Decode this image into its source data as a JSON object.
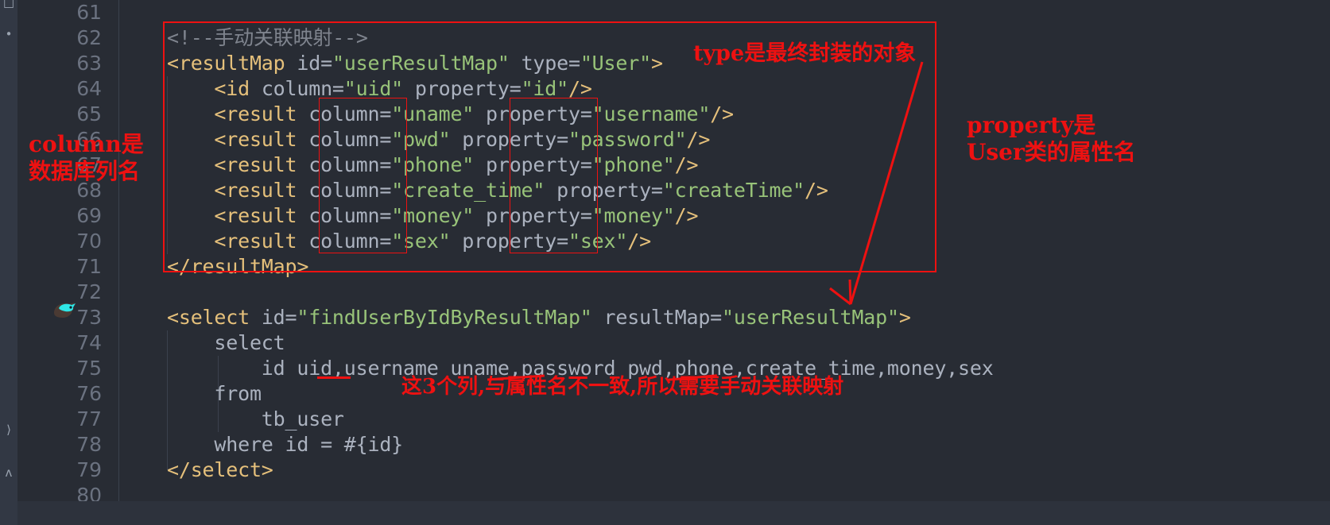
{
  "editor": {
    "background": "#282c34",
    "gutter_background": "#282c34",
    "strip_background": "#323844",
    "linenumber_color": "#6b7280",
    "annotation_color": "#ee1111",
    "line_numbers": [
      "61",
      "62",
      "63",
      "64",
      "65",
      "66",
      "67",
      "68",
      "69",
      "70",
      "71",
      "72",
      "73",
      "74",
      "75",
      "76",
      "77",
      "78",
      "79",
      "80"
    ],
    "gutter_icon_name": "mybatis-statement-gutter-icon"
  },
  "left_strip": {
    "glyphs": [
      "□",
      "•",
      "⟩",
      "ʌ"
    ]
  },
  "code": {
    "lines": [
      {
        "num": "61",
        "segments": []
      },
      {
        "num": "62",
        "segments": [
          {
            "t": "comment",
            "s": "<!--手动关联映射-->"
          }
        ]
      },
      {
        "num": "63",
        "segments": [
          {
            "t": "tag",
            "s": "<resultMap "
          },
          {
            "t": "attr",
            "s": "id="
          },
          {
            "t": "str",
            "s": "\"userResultMap\""
          },
          {
            "t": "attr",
            "s": " type="
          },
          {
            "t": "str",
            "s": "\"User\""
          },
          {
            "t": "tag",
            "s": ">"
          }
        ]
      },
      {
        "num": "64",
        "segments": [
          {
            "t": "plain",
            "s": "    "
          },
          {
            "t": "tag",
            "s": "<id "
          },
          {
            "t": "attr",
            "s": "column="
          },
          {
            "t": "str",
            "s": "\"uid\""
          },
          {
            "t": "attr",
            "s": " property="
          },
          {
            "t": "str",
            "s": "\"id\""
          },
          {
            "t": "tag",
            "s": "/>"
          }
        ]
      },
      {
        "num": "65",
        "segments": [
          {
            "t": "plain",
            "s": "    "
          },
          {
            "t": "tag",
            "s": "<result "
          },
          {
            "t": "attr",
            "s": "column="
          },
          {
            "t": "str",
            "s": "\"uname\""
          },
          {
            "t": "attr",
            "s": " property="
          },
          {
            "t": "str",
            "s": "\"username\""
          },
          {
            "t": "tag",
            "s": "/>"
          }
        ]
      },
      {
        "num": "66",
        "segments": [
          {
            "t": "plain",
            "s": "    "
          },
          {
            "t": "tag",
            "s": "<result "
          },
          {
            "t": "attr",
            "s": "column="
          },
          {
            "t": "str",
            "s": "\"pwd\""
          },
          {
            "t": "attr",
            "s": " property="
          },
          {
            "t": "str",
            "s": "\"password\""
          },
          {
            "t": "tag",
            "s": "/>"
          }
        ]
      },
      {
        "num": "67",
        "segments": [
          {
            "t": "plain",
            "s": "    "
          },
          {
            "t": "tag",
            "s": "<result "
          },
          {
            "t": "attr",
            "s": "column="
          },
          {
            "t": "str",
            "s": "\"phone\""
          },
          {
            "t": "attr",
            "s": " property="
          },
          {
            "t": "str",
            "s": "\"phone\""
          },
          {
            "t": "tag",
            "s": "/>"
          }
        ]
      },
      {
        "num": "68",
        "segments": [
          {
            "t": "plain",
            "s": "    "
          },
          {
            "t": "tag",
            "s": "<result "
          },
          {
            "t": "attr",
            "s": "column="
          },
          {
            "t": "str",
            "s": "\"create_time\""
          },
          {
            "t": "attr",
            "s": " property="
          },
          {
            "t": "str",
            "s": "\"createTime\""
          },
          {
            "t": "tag",
            "s": "/>"
          }
        ]
      },
      {
        "num": "69",
        "segments": [
          {
            "t": "plain",
            "s": "    "
          },
          {
            "t": "tag",
            "s": "<result "
          },
          {
            "t": "attr",
            "s": "column="
          },
          {
            "t": "str",
            "s": "\"money\""
          },
          {
            "t": "attr",
            "s": " property="
          },
          {
            "t": "str",
            "s": "\"money\""
          },
          {
            "t": "tag",
            "s": "/>"
          }
        ]
      },
      {
        "num": "70",
        "segments": [
          {
            "t": "plain",
            "s": "    "
          },
          {
            "t": "tag",
            "s": "<result "
          },
          {
            "t": "attr",
            "s": "column="
          },
          {
            "t": "str",
            "s": "\"sex\""
          },
          {
            "t": "attr",
            "s": " property="
          },
          {
            "t": "str",
            "s": "\"sex\""
          },
          {
            "t": "tag",
            "s": "/>"
          }
        ]
      },
      {
        "num": "71",
        "segments": [
          {
            "t": "tag",
            "s": "</resultMap>"
          }
        ]
      },
      {
        "num": "72",
        "segments": []
      },
      {
        "num": "73",
        "segments": [
          {
            "t": "tag",
            "s": "<select "
          },
          {
            "t": "attr",
            "s": "id="
          },
          {
            "t": "str",
            "s": "\"findUserByIdByResultMap\""
          },
          {
            "t": "attr",
            "s": " resultMap="
          },
          {
            "t": "str",
            "s": "\"userResultMap\""
          },
          {
            "t": "tag",
            "s": ">"
          }
        ]
      },
      {
        "num": "74",
        "segments": [
          {
            "t": "plain",
            "s": "    select"
          }
        ]
      },
      {
        "num": "75",
        "segments": [
          {
            "t": "plain",
            "s": "        id uid,username uname,password pwd,phone,create_time,money,sex"
          }
        ]
      },
      {
        "num": "76",
        "segments": [
          {
            "t": "plain",
            "s": "    from"
          }
        ]
      },
      {
        "num": "77",
        "segments": [
          {
            "t": "plain",
            "s": "        tb_user"
          }
        ]
      },
      {
        "num": "78",
        "segments": [
          {
            "t": "plain",
            "s": "    where id = #{id}"
          }
        ]
      },
      {
        "num": "79",
        "segments": [
          {
            "t": "tag",
            "s": "</select>"
          }
        ]
      },
      {
        "num": "80",
        "segments": []
      }
    ]
  },
  "annotations": {
    "type_note": "type是最终封装的对象",
    "property_note_line1": "property是",
    "property_note_line2": "User类的属性名",
    "column_note_line1": "column是",
    "column_note_line2": "数据库列名",
    "mismatch_note": "这3个列,与属性名不一致,所以需要手动关联映射",
    "underlined_columns": [
      "uid",
      "uname",
      "pwd"
    ],
    "boxed_regions": [
      "resultMap-block",
      "column-attribute-column",
      "property-attribute-column"
    ]
  }
}
